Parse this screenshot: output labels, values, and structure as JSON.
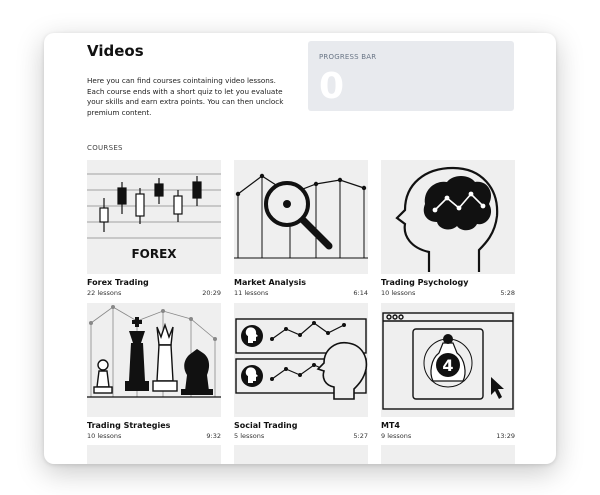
{
  "page": {
    "title": "Videos",
    "intro": "Here you can find courses cointaining video lessons. Each course ends with a short quiz to let you evaluate your skills and earn extra points. You can then unclock premium content."
  },
  "progress": {
    "label": "PROGRESS BAR",
    "value": "0",
    "fraction": 0
  },
  "courses_label": "COURSES",
  "courses": [
    {
      "title": "Forex Trading",
      "lessons": "22 lessons",
      "duration": "20:29",
      "thumb_text": "FOREX",
      "icon": "candlestick-chart-icon"
    },
    {
      "title": "Market Analysis",
      "lessons": "11 lessons",
      "duration": "6:14",
      "icon": "magnifier-chart-icon"
    },
    {
      "title": "Trading Psychology",
      "lessons": "10 lessons",
      "duration": "5:28",
      "icon": "brain-head-icon"
    },
    {
      "title": "Trading Strategies",
      "lessons": "10 lessons",
      "duration": "9:32",
      "icon": "chess-pieces-icon"
    },
    {
      "title": "Social Trading",
      "lessons": "5 lessons",
      "duration": "5:27",
      "icon": "social-heads-icon"
    },
    {
      "title": "MT4",
      "lessons": "9 lessons",
      "duration": "13:29",
      "thumb_text": "4",
      "icon": "mt4-window-icon"
    }
  ]
}
